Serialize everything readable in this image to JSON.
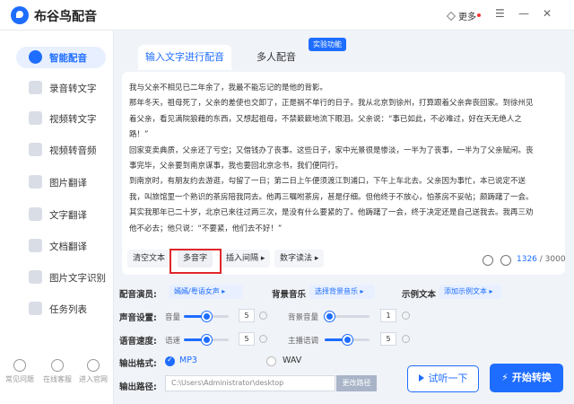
{
  "app": {
    "title": "布谷鸟配音",
    "more_label": "更多"
  },
  "sidebar": {
    "items": [
      {
        "label": "智能配音"
      },
      {
        "label": "录音转文字"
      },
      {
        "label": "视频转文字"
      },
      {
        "label": "视频转音频"
      },
      {
        "label": "图片翻译"
      },
      {
        "label": "文字翻译"
      },
      {
        "label": "文档翻译"
      },
      {
        "label": "图片文字识别"
      },
      {
        "label": "任务列表"
      }
    ],
    "bottom": [
      {
        "label": "常见问题"
      },
      {
        "label": "在线客服"
      },
      {
        "label": "进入官网"
      }
    ]
  },
  "tabs": [
    {
      "label": "输入文字进行配音"
    },
    {
      "label": "多人配音"
    }
  ],
  "lab_badge": "实验功能",
  "editor": {
    "lines": [
      "我与父亲不相见已二年余了，我最不能忘记的是他的背影。",
      "那年冬天，祖母死了，父亲的差使也交卸了，正是祸不单行的日子。我从北京到徐州，打算跟着父亲奔丧回家。到徐州见",
      "着父亲，看见满院狼藉的东西，又想起祖母，不禁簌簌地流下眼泪。父亲说：“事已如此，不必难过，好在天无绝人之",
      "路！”",
      "回家变卖典质，父亲还了亏空；又借钱办了丧事。这些日子，家中光景很是惨淡，一半为了丧事，一半为了父亲赋闲。丧",
      "事完毕，父亲要到南京谋事，我也要回北京念书，我们便同行。",
      "到南京时，有朋友约去游逛，勾留了一日；第二日上午便须渡江到浦口，下午上车北去。父亲因为事忙，本已说定不送",
      "我，叫旅馆里一个熟识的茶房陪我同去。他再三嘱咐茶房，甚是仔细。但他终于不放心，怕茶房不妥帖；颇踌躇了一会。",
      "其实我那年已二十岁，北京已来往过两三次，是没有什么要紧的了。他踌躇了一会，终于决定还是自己送我去。我再三劝",
      "他不必去；他只说：“不要紧，他们去不好！”"
    ],
    "toolbar": {
      "clear": "清空文本",
      "polyphone": "多音字",
      "insert_pause": "插入间隔",
      "digit_read": "数字读法"
    },
    "count": "1326",
    "max": "3000"
  },
  "settings": {
    "voice_label": "配音演员:",
    "voice_value": "嫣嫣/粤语女声",
    "bgm_label": "背景音乐",
    "bgm_value": "选择背景音乐",
    "example_label": "示例文本",
    "example_value": "添加示例文本",
    "volume_label": "声音设置:",
    "volume_sub": "音量",
    "volume_value": "5",
    "volume_level": 0.5,
    "bg_volume_sub": "背景音量",
    "bg_volume_value": "1",
    "bg_volume_level": 0.1,
    "speed_label": "语音速度:",
    "speed_sub": "语速",
    "speed_value": "5",
    "speed_level": 0.5,
    "pitch_sub": "主播语调",
    "pitch_value": "5",
    "pitch_level": 0.5,
    "format_label": "输出格式:",
    "format_mp3": "MP3",
    "format_wav": "WAV",
    "path_label": "输出路径:",
    "path_value": "C:\\Users\\Administrator\\desktop",
    "path_button": "更改路径",
    "preview_button": "试听一下",
    "start_button": "开始转换"
  },
  "colors": {
    "accent": "#1e6dff",
    "highlight": "#e0262b"
  }
}
